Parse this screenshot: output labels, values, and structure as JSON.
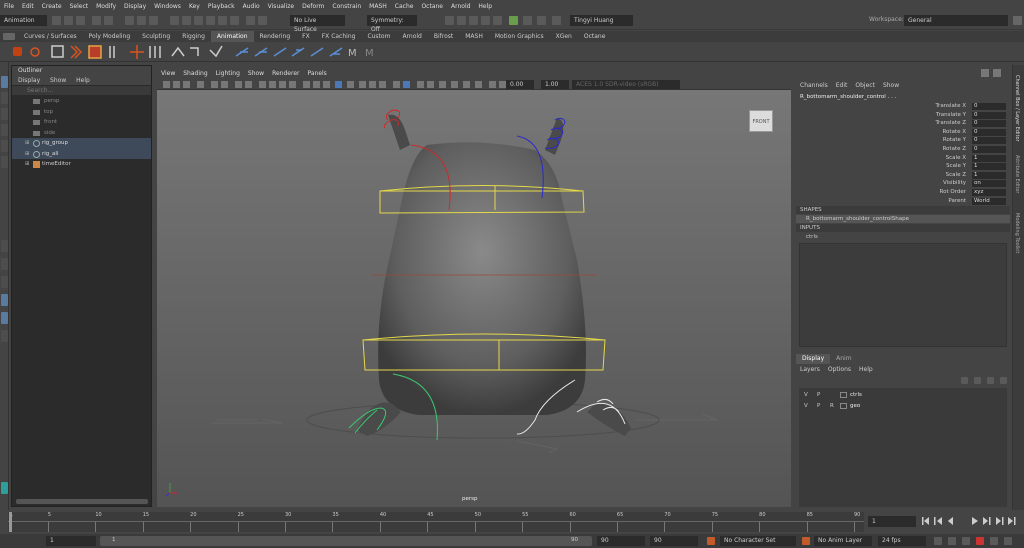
{
  "menubar": {
    "items": [
      "File",
      "Edit",
      "Create",
      "Select",
      "Modify",
      "Display",
      "Windows",
      "Key",
      "Playback",
      "Audio",
      "Visualize",
      "Deform",
      "Constrain",
      "MASH",
      "Cache",
      "Octane",
      "Arnold",
      "Help"
    ],
    "workspace_label": "Workspace:",
    "workspace_value": "General"
  },
  "statusline": {
    "menuset": "Animation",
    "live_surface": "No Live Surface",
    "symmetry": "Symmetry: Off",
    "user": "Tingyi Huang"
  },
  "shelf_tabs": [
    "Curves / Surfaces",
    "Poly Modeling",
    "Sculpting",
    "Rigging",
    "Animation",
    "Rendering",
    "FX",
    "FX Caching",
    "Custom",
    "Arnold",
    "Bifrost",
    "MASH",
    "Motion Graphics",
    "XGen",
    "Octane"
  ],
  "shelf_active": "Animation",
  "outliner": {
    "title": "Outliner",
    "menu": [
      "Display",
      "Show",
      "Help"
    ],
    "search_placeholder": "Search...",
    "items": [
      {
        "label": "persp",
        "sel": false
      },
      {
        "label": "top",
        "sel": false
      },
      {
        "label": "front",
        "sel": false
      },
      {
        "label": "side",
        "sel": false
      },
      {
        "label": "rig_group",
        "sel": true
      },
      {
        "label": "rig_all",
        "sel": true
      },
      {
        "label": "timeEditor",
        "sel": false
      }
    ]
  },
  "viewport": {
    "menu": [
      "View",
      "Shading",
      "Lighting",
      "Show",
      "Renderer",
      "Panels"
    ],
    "field1": "0.00",
    "field2": "1.00",
    "colorspace": "ACES 1.0 SDR-video (sRGB)",
    "camera_label": "persp",
    "viewcube": "FRONT"
  },
  "channel_box": {
    "menu": [
      "Channels",
      "Edit",
      "Object",
      "Show"
    ],
    "node": "R_bottomarm_shoulder_control . . .",
    "attrs": [
      {
        "label": "Translate X",
        "value": "0"
      },
      {
        "label": "Translate Y",
        "value": "0"
      },
      {
        "label": "Translate Z",
        "value": "0"
      },
      {
        "label": "Rotate X",
        "value": "0"
      },
      {
        "label": "Rotate Y",
        "value": "0"
      },
      {
        "label": "Rotate Z",
        "value": "0"
      },
      {
        "label": "Scale X",
        "value": "1"
      },
      {
        "label": "Scale Y",
        "value": "1"
      },
      {
        "label": "Scale Z",
        "value": "1"
      },
      {
        "label": "Visibility",
        "value": "on"
      },
      {
        "label": "Rot Order",
        "value": "xyz"
      },
      {
        "label": "Parent",
        "value": "World"
      }
    ],
    "shapes_header": "SHAPES",
    "shape_name": "R_bottomarm_shoulder_controlShape",
    "inputs_header": "INPUTS",
    "input_name": "ctrls"
  },
  "layer_editor": {
    "tabs": [
      "Display",
      "Anim"
    ],
    "menu": [
      "Layers",
      "Options",
      "Help"
    ],
    "layers": [
      {
        "v": "V",
        "p": "P",
        "r": "",
        "name": "ctrls"
      },
      {
        "v": "V",
        "p": "P",
        "r": "R",
        "name": "geo"
      }
    ]
  },
  "right_tabs": [
    "Channel Box / Layer Editor",
    "Attribute Editor",
    "Modeling Toolkit"
  ],
  "timeline": {
    "ticks": [
      "1",
      "5",
      "10",
      "15",
      "20",
      "25",
      "30",
      "35",
      "40",
      "45",
      "50",
      "55",
      "60",
      "65",
      "70",
      "75",
      "80",
      "85",
      "90"
    ],
    "current_frame": "1"
  },
  "range": {
    "start": "1",
    "inner_start": "1",
    "inner_end": "90",
    "end1": "90",
    "end2": "90",
    "character_set": "No Character Set",
    "anim_layer": "No Anim Layer",
    "fps": "24 fps"
  }
}
